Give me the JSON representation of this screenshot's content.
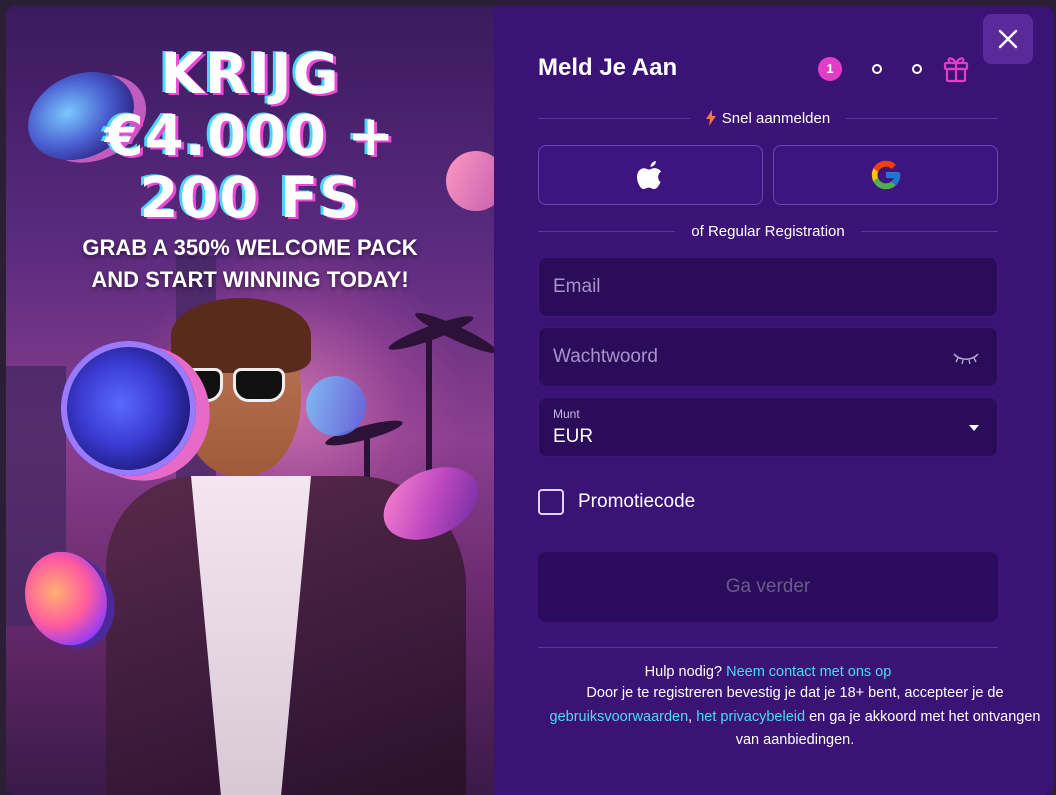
{
  "promo": {
    "headline_line1": "KRIJG",
    "headline_line2": "€4.000 +",
    "headline_line3": "200 FS",
    "subline_line1": "GRAB A 350% WELCOME PACK",
    "subline_line2": "AND START WINNING TODAY!"
  },
  "form": {
    "title": "Meld Je Aan",
    "step_current": "1",
    "quick_signup_label": "Snel aanmelden",
    "regular_label": "of Regular Registration",
    "email_placeholder": "Email",
    "password_placeholder": "Wachtwoord",
    "currency_label": "Munt",
    "currency_value": "EUR",
    "promo_code_label": "Promotiecode",
    "submit_label": "Ga verder"
  },
  "footer": {
    "help_text": "Hulp nodig?",
    "help_link": "Neem contact met ons op",
    "terms_prefix": "Door je te registreren bevestig je dat je 18+ bent, accepteer je de",
    "terms_link1": "gebruiksvoorwaarden",
    "terms_sep": ",",
    "terms_link2": "het privacybeleid",
    "terms_suffix": "en ga je akkoord met het ontvangen van aanbiedingen."
  },
  "icons": {
    "close": "close-icon",
    "gift": "gift-icon",
    "lightning": "lightning-icon",
    "apple": "apple-icon",
    "google": "google-icon",
    "eye": "eye-closed-icon",
    "caret": "chevron-down-icon"
  },
  "colors": {
    "panel_bg": "#3b1376",
    "accent_pink": "#e23cc8",
    "link_cyan": "#4adcf0",
    "field_bg": "#2a0c5a"
  }
}
